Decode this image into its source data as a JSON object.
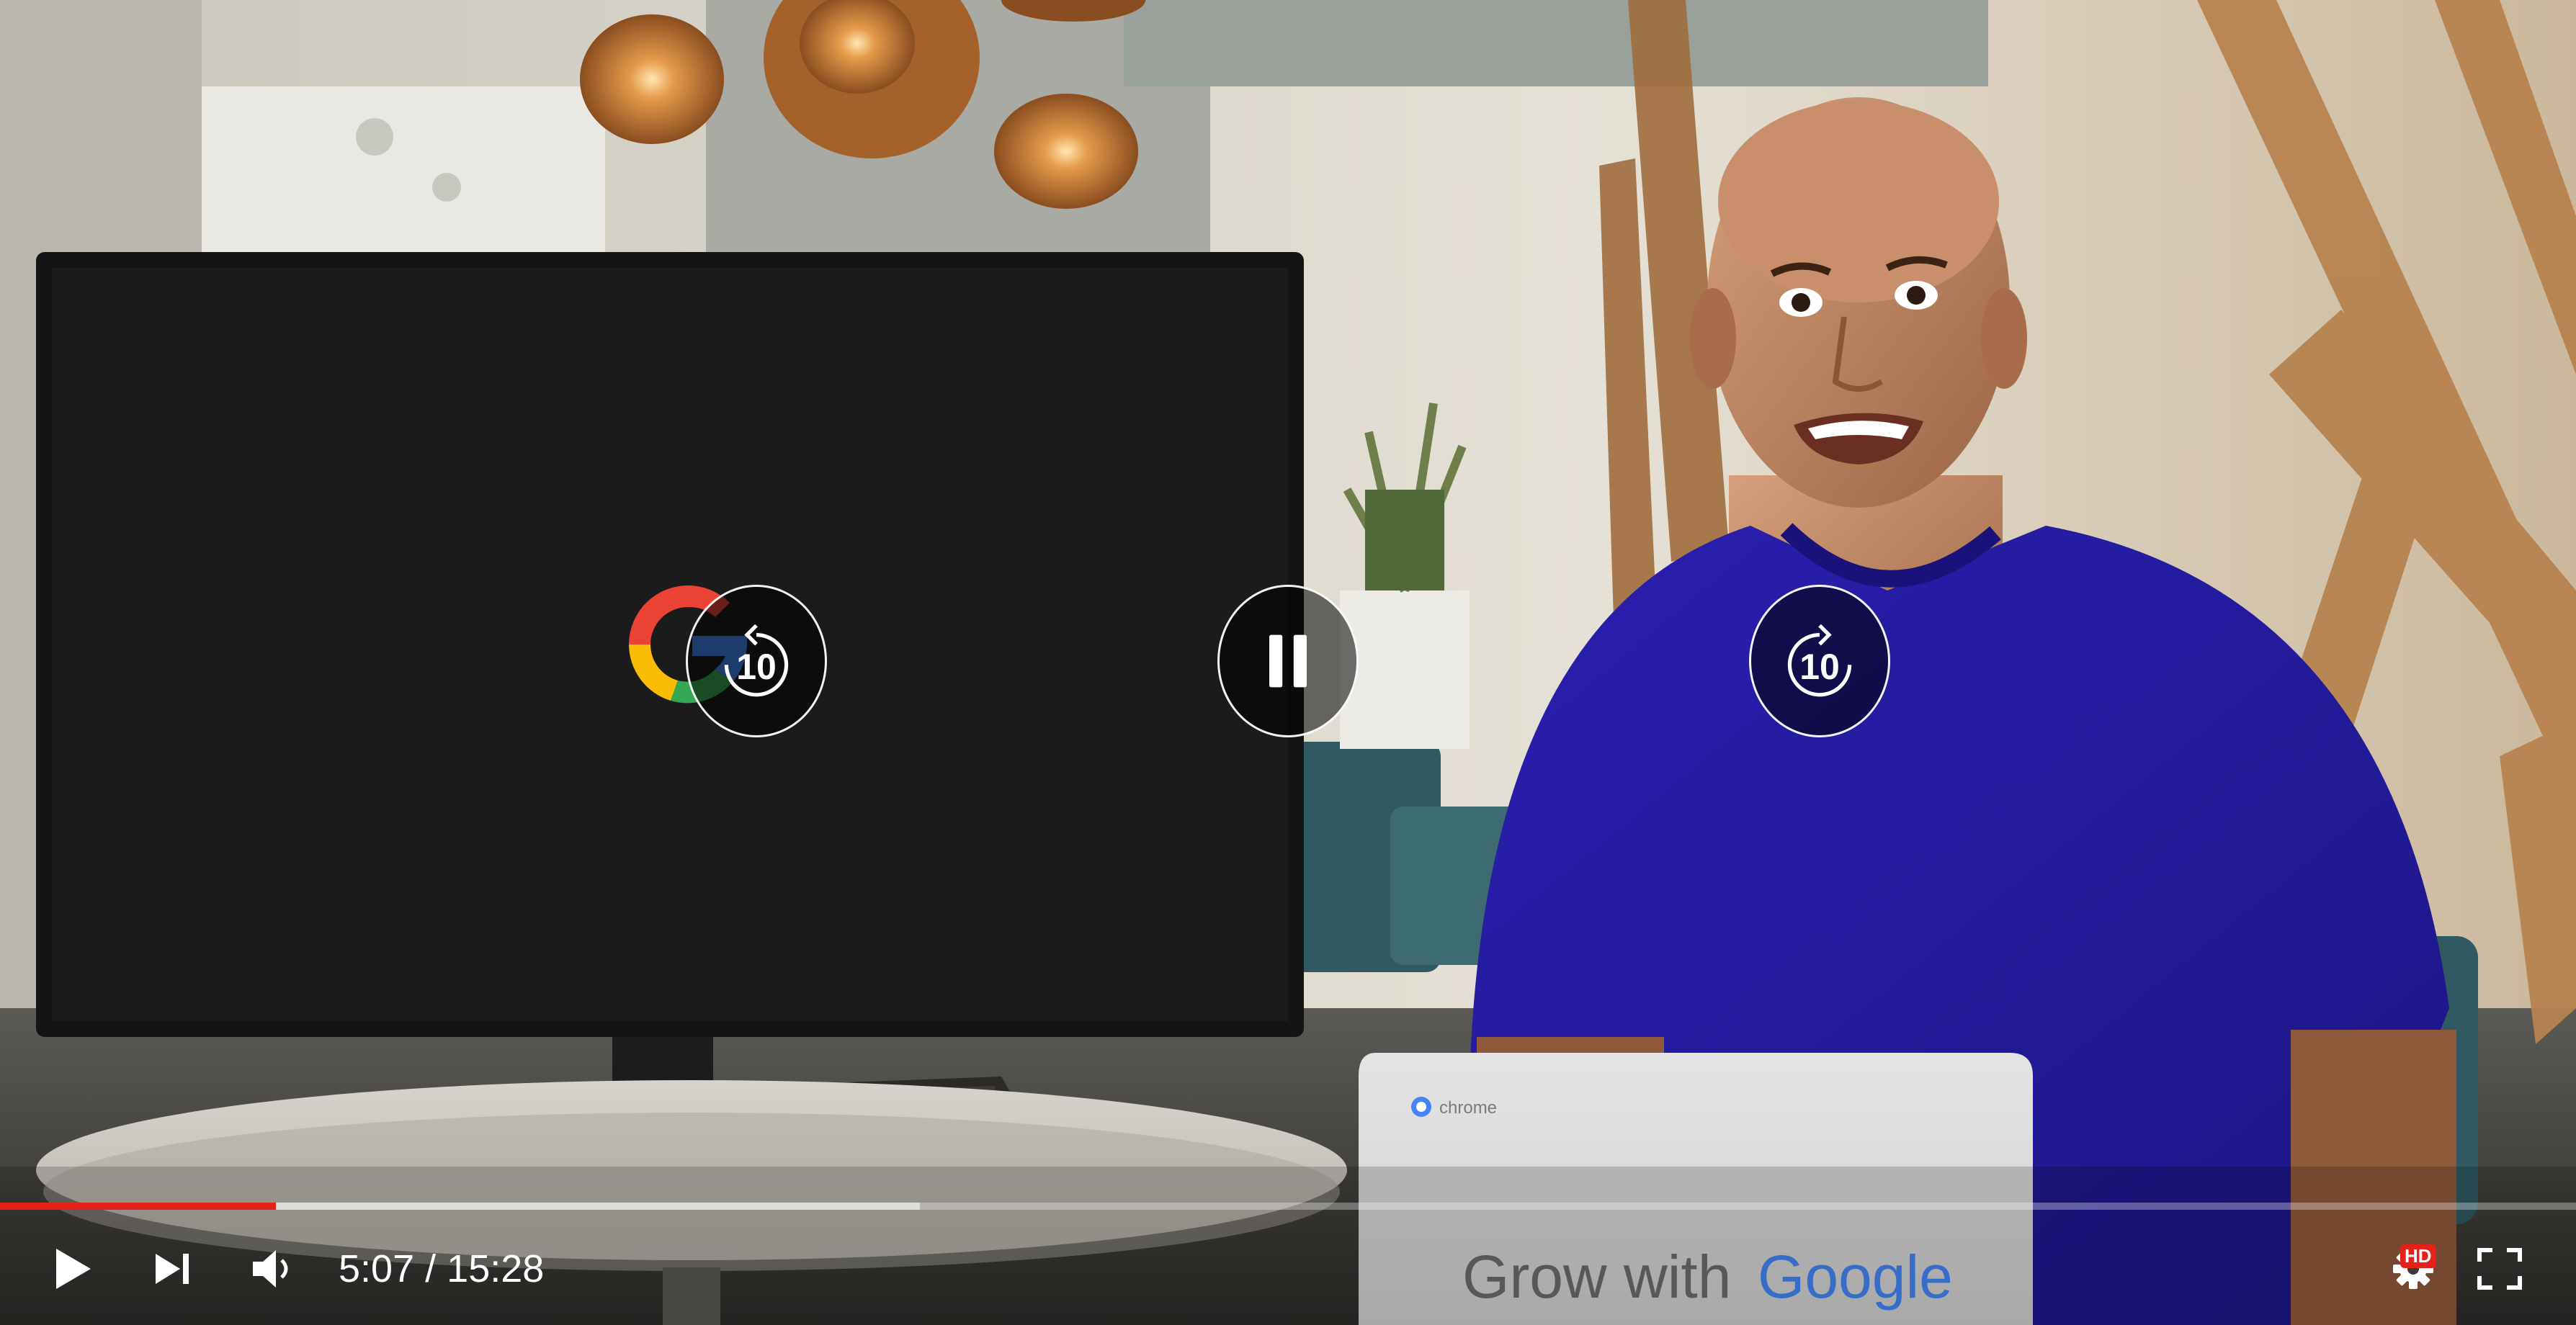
{
  "player": {
    "current_time": "5:07",
    "time_separator": "/",
    "duration": "15:28",
    "progress_played_fraction": 0.107,
    "progress_buffered_fraction": 0.357,
    "accent_color": "#e62117",
    "state": "playing"
  },
  "overlay": {
    "rewind_seconds": "10",
    "forward_seconds": "10"
  },
  "controls": {
    "play_icon": "play-icon",
    "next_icon": "next-icon",
    "volume_icon": "volume-icon",
    "settings_icon": "gear-icon",
    "settings_badge": "HD",
    "fullscreen_icon": "fullscreen-icon"
  },
  "video_frame": {
    "laptop_brand": "chrome",
    "laptop_text_prefix": "Grow with",
    "laptop_text_brand": "Google"
  }
}
